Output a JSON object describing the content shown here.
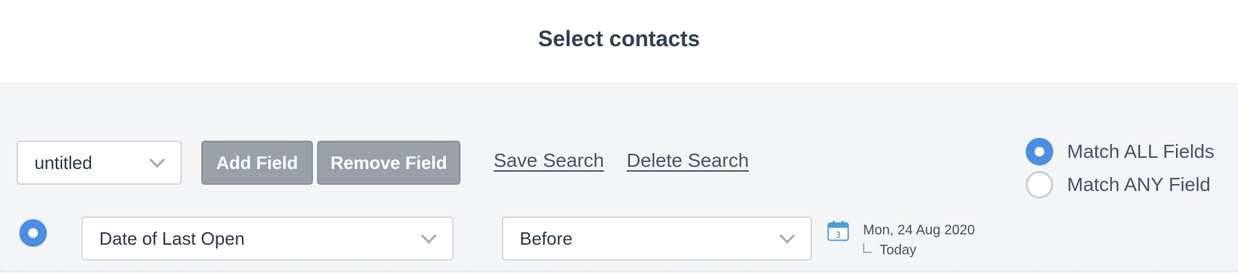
{
  "header": {
    "title": "Select contacts"
  },
  "toolbar": {
    "search_select_value": "untitled",
    "add_field_label": "Add Field",
    "remove_field_label": "Remove Field",
    "save_search_label": "Save Search",
    "delete_search_label": "Delete Search"
  },
  "match": {
    "all_label": "Match ALL Fields",
    "any_label": "Match ANY Field",
    "selected": "all"
  },
  "criteria_row": {
    "field_value": "Date of Last Open",
    "operator_value": "Before",
    "date_value": "Mon, 24 Aug 2020",
    "relative_label": "Today",
    "calendar_day": "3",
    "selected": true
  },
  "colors": {
    "accent": "#4b8fe2",
    "button_gray": "#9aa0a8",
    "panel_bg": "#f4f5f7"
  },
  "icons": {
    "chevron": "chevron-down-icon",
    "calendar": "calendar-icon",
    "radio": "radio-icon"
  }
}
